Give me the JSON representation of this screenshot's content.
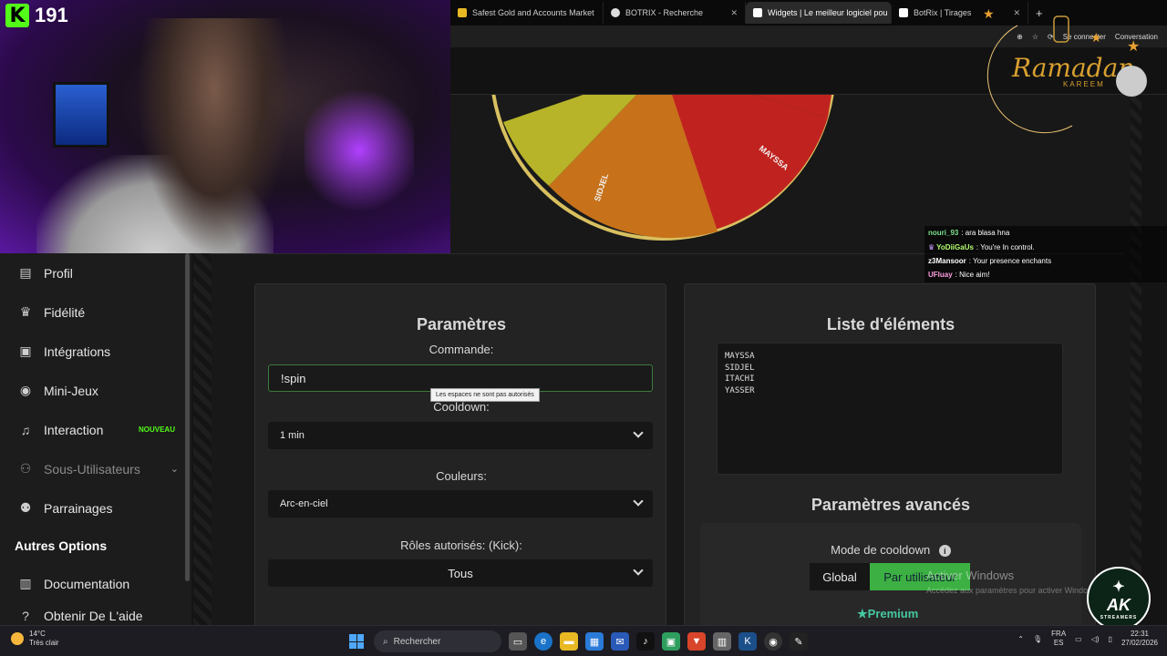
{
  "stream": {
    "viewer_count": "191",
    "platform_logo": "K"
  },
  "browser": {
    "tabs": [
      {
        "label": "Safest Gold and Accounts Market",
        "icon": "shop-icon",
        "active": false
      },
      {
        "label": "BOTRIX - Recherche",
        "icon": "search-icon",
        "active": false
      },
      {
        "label": "Widgets | Le meilleur logiciel pou",
        "icon": "botrix-icon",
        "active": true
      },
      {
        "label": "BotRix | Tirages",
        "icon": "botrix-icon",
        "active": false
      }
    ],
    "signin_label": "Se connecter",
    "conversation_label": "Conversation"
  },
  "sidebar": {
    "items": [
      {
        "label": "Profil",
        "icon": "id-card-icon"
      },
      {
        "label": "Fidélité",
        "icon": "trophy-icon"
      },
      {
        "label": "Intégrations",
        "icon": "integrations-icon"
      },
      {
        "label": "Mini-Jeux",
        "icon": "gamepad-icon"
      },
      {
        "label": "Interaction",
        "icon": "music-icon",
        "badge": "NOUVEAU"
      },
      {
        "label": "Sous-Utilisateurs",
        "icon": "users-icon",
        "disabled": true
      },
      {
        "label": "Parrainages",
        "icon": "referral-icon"
      }
    ],
    "section_heading": "Autres Options",
    "other_items": [
      {
        "label": "Documentation",
        "icon": "book-icon"
      },
      {
        "label": "Obtenir De L'aide",
        "icon": "help-icon"
      }
    ]
  },
  "wheel": {
    "segments": [
      {
        "label": "MAYSSA",
        "color": "#c0231f"
      },
      {
        "label": "SIDJEL",
        "color": "#c7721b"
      },
      {
        "label": "",
        "color": "#b7b42a"
      }
    ],
    "rim_color": "#d8c060"
  },
  "params": {
    "title": "Paramètres",
    "command_label": "Commande:",
    "command_value": "!spin",
    "tooltip": "Les espaces ne sont pas autorisés",
    "cooldown_label": "Cooldown:",
    "cooldown_value": "1 min",
    "colors_label": "Couleurs:",
    "colors_value": "Arc-en-ciel",
    "roles_label": "Rôles autorisés: (Kick):",
    "roles_value": "Tous"
  },
  "list": {
    "title": "Liste d'éléments",
    "items_text": "MAYSSA\nSIDJEL\nITACHI\nYASSER"
  },
  "advanced": {
    "title": "Paramètres avancés",
    "cooldown_mode_label": "Mode de cooldown",
    "global_label": "Global",
    "per_user_label": "Par utilisateur",
    "premium_label": "Premium"
  },
  "overlay": {
    "ramadan_text": "Ramadan",
    "ramadan_sub": "KAREEM",
    "chat": [
      {
        "user": "nouri_93",
        "color": "#7be08a",
        "message": ": ara blasa hna"
      },
      {
        "user": "YoDiiGaUs",
        "color": "#b4ff6e",
        "message": ": You're In control."
      },
      {
        "user": "z3Mansoor",
        "color": "#ffffff",
        "message": ": Your presence enchants"
      },
      {
        "user": "UFluay",
        "color": "#ff9ee0",
        "message": ": Nice aim!"
      }
    ],
    "watermark_line1": "Activer Windows",
    "watermark_line2": "Accédez aux paramètres pour activer Windows.",
    "ak_text": "AK",
    "ak_sub": "STREAMERS"
  },
  "taskbar": {
    "temperature": "14°C",
    "weather": "Très clair",
    "search_placeholder": "Rechercher",
    "lang_top": "FRA",
    "lang_bottom": "ES",
    "time": "22:31",
    "date": "27/02/2026"
  }
}
